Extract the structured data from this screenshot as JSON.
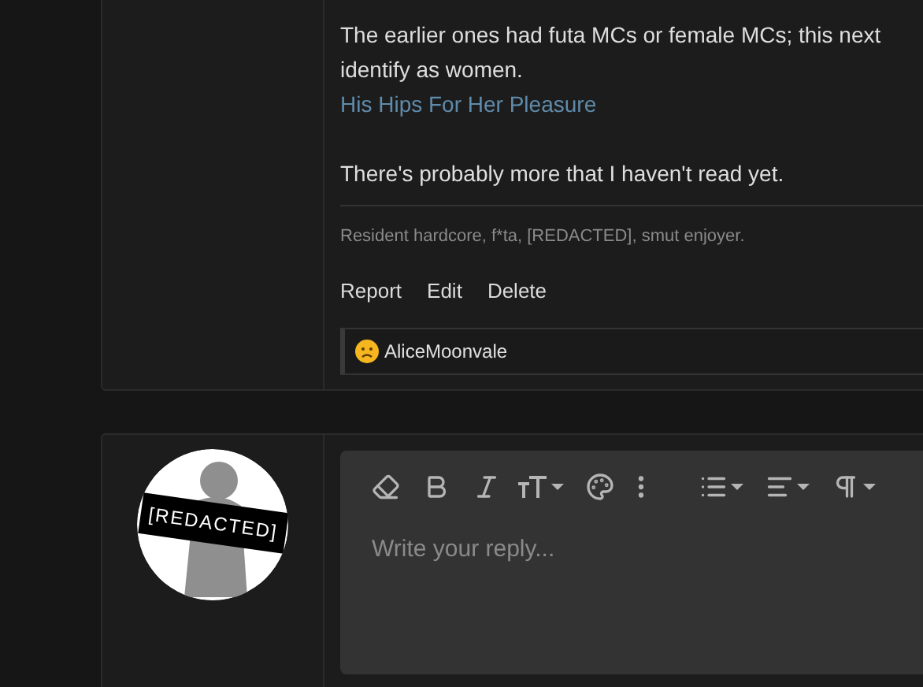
{
  "post": {
    "paragraphs": [
      {
        "kind": "text",
        "text": "The earlier ones had futa MCs or female MCs; this next identify as women."
      },
      {
        "kind": "link",
        "text": "His Hips For Her Pleasure"
      },
      {
        "kind": "text",
        "text": "There's probably more that I haven't read yet."
      }
    ],
    "signature": "Resident hardcore, f*ta, [REDACTED], smut enjoyer.",
    "actions": [
      "Report",
      "Edit",
      "Delete"
    ],
    "reactions": {
      "users": "AliceMoonvale"
    }
  },
  "reply": {
    "avatar": {
      "label": "[REDACTED]"
    },
    "editor": {
      "placeholder": "Write your reply..."
    }
  }
}
